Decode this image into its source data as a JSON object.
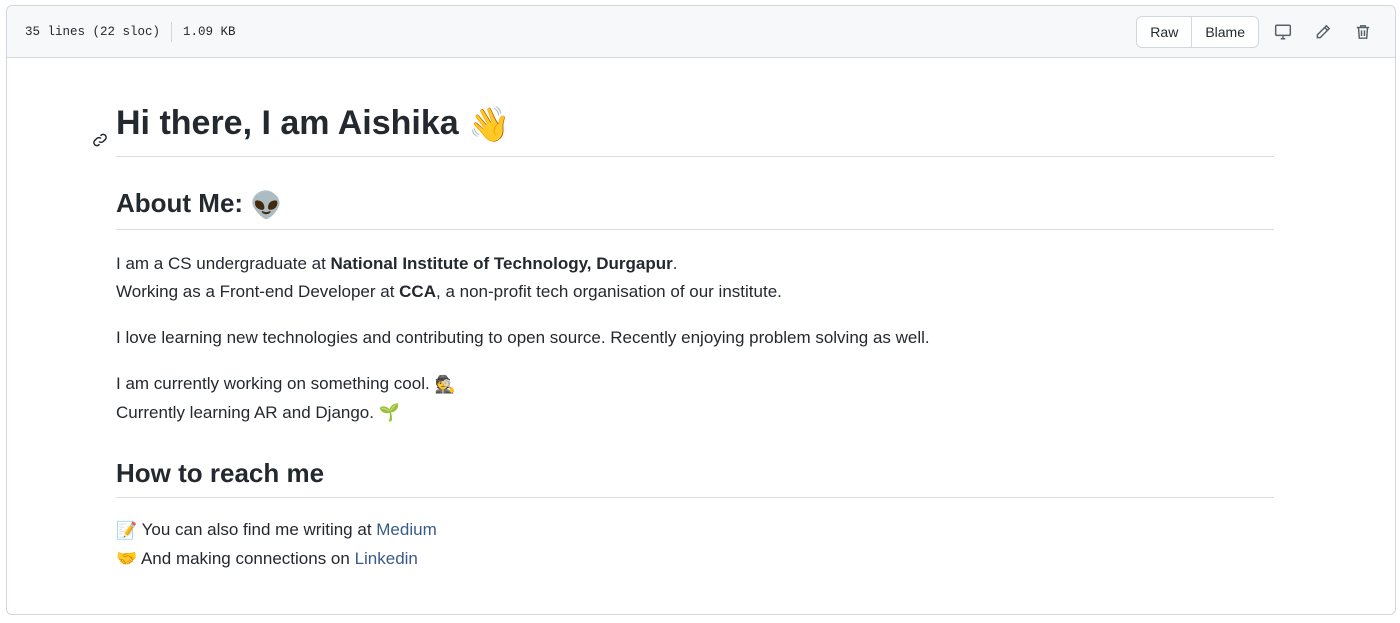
{
  "file_header": {
    "lines": "35 lines (22 sloc)",
    "size": "1.09 KB",
    "raw_label": "Raw",
    "blame_label": "Blame"
  },
  "readme": {
    "title": "Hi there, I am Aishika",
    "title_emoji": "👋",
    "about_heading": "About Me:",
    "about_emoji": "👽",
    "p1_a": "I am a CS undergraduate at ",
    "p1_b": "National Institute of Technology, Durgapur",
    "p1_c": ".",
    "p1_d": "Working as a Front-end Developer at ",
    "p1_e": "CCA",
    "p1_f": ", a non-profit tech organisation of our institute.",
    "p2": "I love learning new technologies and contributing to open source. Recently enjoying problem solving as well.",
    "p3_a": "I am currently working on something cool.",
    "p3_emoji": "🕵",
    "p3_b": "Currently learning AR and Django.",
    "p3_emoji2": "🌱",
    "reach_heading": "How to reach me",
    "reach_1_emoji": "📝",
    "reach_1_text": "You can also find me writing at ",
    "reach_1_link": "Medium",
    "reach_2_emoji": "🤝",
    "reach_2_text": "And making connections on ",
    "reach_2_link": "Linkedin"
  },
  "icons": [
    "link-icon",
    "desktop-icon",
    "pencil-icon",
    "trash-icon"
  ]
}
